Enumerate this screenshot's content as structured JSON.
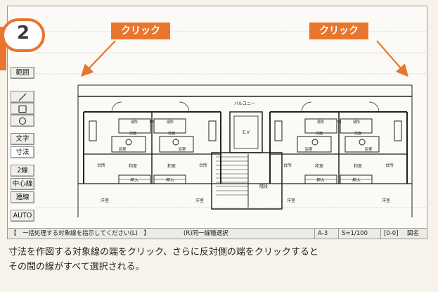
{
  "step_number": "2",
  "callouts": {
    "left": "クリック",
    "right": "クリック"
  },
  "palette": {
    "top_button": "範囲",
    "line_icon": "line-tool-icon",
    "rect_icon": "rectangle-tool-icon",
    "circle_icon": "circle-tool-icon",
    "items": [
      "文字",
      "寸法",
      "2線",
      "中心線",
      "連線",
      "AUTO"
    ]
  },
  "plan_labels": {
    "balcony": "バルコニー",
    "ev": "E.V",
    "stairs": "階段",
    "rooms": [
      "和室",
      "洋室",
      "押入",
      "台所",
      "浴室",
      "洗面",
      "便所",
      "P.S"
    ]
  },
  "statusbar": {
    "message": "【　一括処理する対象線を指示してください(L)　】",
    "mode": "(R)同一線種選択",
    "layer": "A-3",
    "scale": "S=1/100",
    "group": "[0-0]",
    "name": "図名"
  },
  "caption": {
    "line1": "寸法を作図する対象線の端をクリック、さらに反対側の端をクリックすると",
    "line2": "その間の線がすべて選択される。"
  },
  "colors": {
    "accent": "#e8762e",
    "line": "#222222",
    "guide": "#b7c6c6"
  }
}
